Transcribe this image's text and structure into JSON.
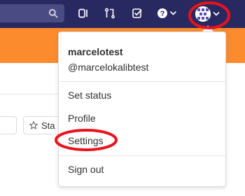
{
  "navbar": {
    "search_placeholder": "",
    "icons": [
      "search-icon",
      "merge-requests-icon",
      "pull-request-icon",
      "todo-icon",
      "help-icon",
      "avatar",
      "chevron-down-icon"
    ]
  },
  "page": {
    "star_button_label": "Sta"
  },
  "dropdown": {
    "user_name": "marcelotest",
    "user_handle": "@marcelokalibtest",
    "items": [
      {
        "label": "Set status"
      },
      {
        "label": "Profile"
      },
      {
        "label": "Settings"
      },
      {
        "label": "Sign out"
      }
    ]
  },
  "colors": {
    "navbar": "#292961",
    "banner": "#fc8b2e",
    "highlight": "#e8131b"
  }
}
